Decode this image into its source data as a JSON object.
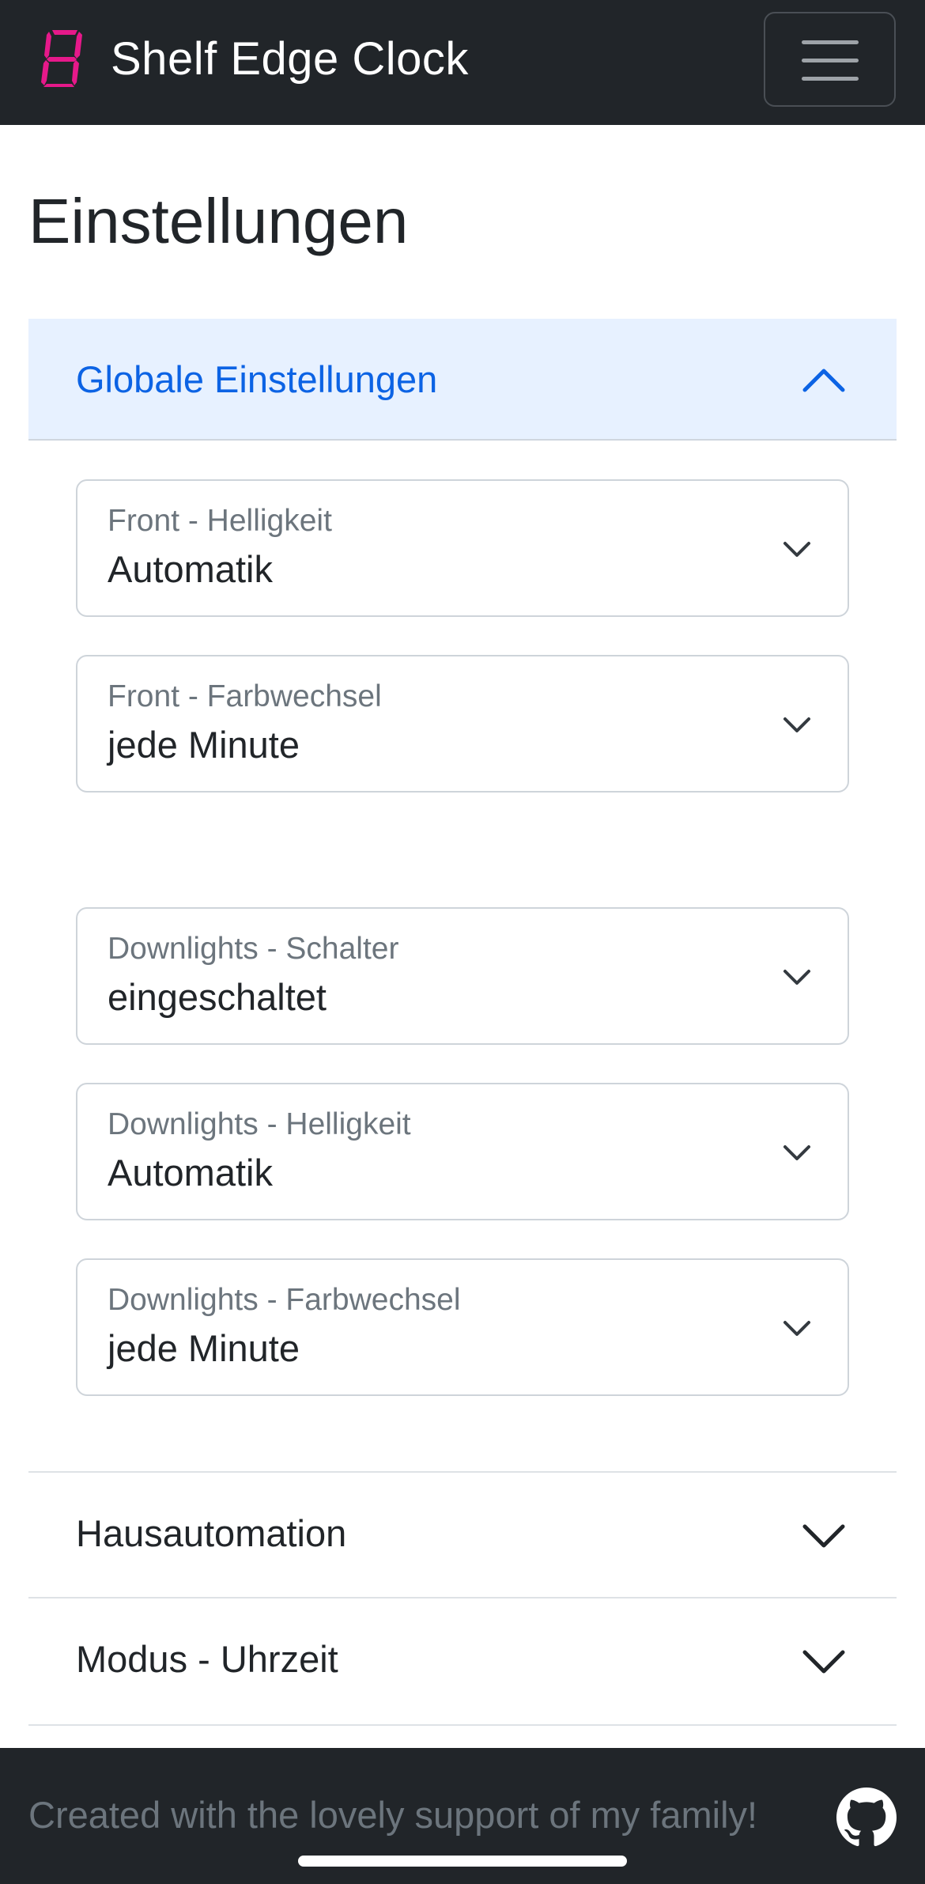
{
  "navbar": {
    "brand_icon": "seven-segment-digit-icon",
    "brand_title": "Shelf Edge Clock",
    "toggle_icon": "hamburger-menu-icon",
    "brand_color": "#e6198a"
  },
  "page": {
    "title": "Einstellungen"
  },
  "accordion": {
    "open_section": {
      "label": "Globale Einstellungen",
      "icon": "chevron-up-icon",
      "fields": [
        {
          "label": "Front - Helligkeit",
          "value": "Automatik"
        },
        {
          "label": "Front - Farbwechsel",
          "value": "jede Minute"
        },
        {
          "label": "Downlights - Schalter",
          "value": "eingeschaltet"
        },
        {
          "label": "Downlights - Helligkeit",
          "value": "Automatik"
        },
        {
          "label": "Downlights - Farbwechsel",
          "value": "jede Minute"
        }
      ]
    },
    "collapsed_sections": [
      {
        "label": "Hausautomation",
        "icon": "chevron-down-icon"
      },
      {
        "label": "Modus - Uhrzeit",
        "icon": "chevron-down-icon"
      }
    ]
  },
  "footer": {
    "text": "Created with the lovely support of my family!",
    "icon": "github-icon"
  }
}
